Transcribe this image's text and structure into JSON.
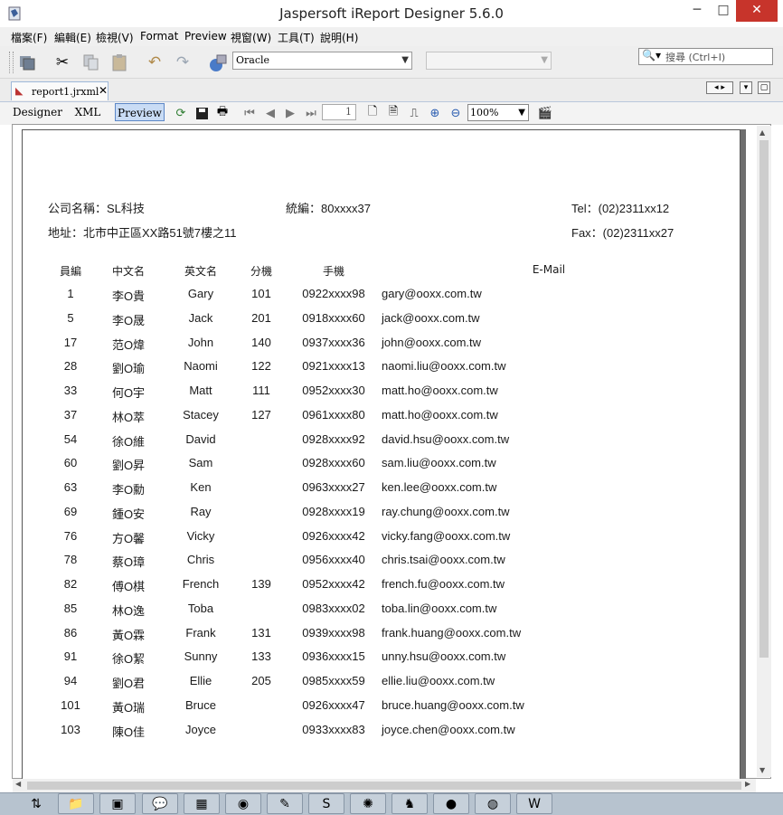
{
  "window": {
    "title": "Jaspersoft iReport Designer 5.6.0",
    "minimize": "─",
    "maximize": "□",
    "close": "✕"
  },
  "menu": [
    "檔案(F)",
    "編輯(E)",
    "檢視(V)",
    "Format",
    "Preview",
    "視窗(W)",
    "工具(T)",
    "說明(H)"
  ],
  "toolbar": {
    "datasource_value": "Oracle",
    "second_combo_value": "",
    "search_placeholder": "搜尋 (Ctrl+I)"
  },
  "tab": {
    "label": "report1.jrxml",
    "close": "✕"
  },
  "editor": {
    "modes": [
      "Designer",
      "XML",
      "Preview"
    ],
    "active_mode": "Preview",
    "page_number": "1",
    "zoom": "100%"
  },
  "report": {
    "company_label": "公司名稱：SL科技",
    "tax_id_label": "統編：80xxxx37",
    "tel_label": "Tel：(02)2311xx12",
    "address_label": "地址：北市中正區XX路51號7樓之11",
    "fax_label": "Fax：(02)2311xx27",
    "columns": [
      "員編",
      "中文名",
      "英文名",
      "分機",
      "手機",
      "E-Mail"
    ],
    "rows": [
      [
        "1",
        "李O貴",
        "Gary",
        "101",
        "0922xxxx98",
        "gary@ooxx.com.tw"
      ],
      [
        "5",
        "李O晟",
        "Jack",
        "201",
        "0918xxxx60",
        "jack@ooxx.com.tw"
      ],
      [
        "17",
        "范O煒",
        "John",
        "140",
        "0937xxxx36",
        "john@ooxx.com.tw"
      ],
      [
        "28",
        "劉O瑜",
        "Naomi",
        "122",
        "0921xxxx13",
        "naomi.liu@ooxx.com.tw"
      ],
      [
        "33",
        "何O宇",
        "Matt",
        "111",
        "0952xxxx30",
        "matt.ho@ooxx.com.tw"
      ],
      [
        "37",
        "林O萃",
        "Stacey",
        "127",
        "0961xxxx80",
        "matt.ho@ooxx.com.tw"
      ],
      [
        "54",
        "徐O維",
        "David",
        "",
        "0928xxxx92",
        "david.hsu@ooxx.com.tw"
      ],
      [
        "60",
        "劉O昇",
        "Sam",
        "",
        "0928xxxx60",
        "sam.liu@ooxx.com.tw"
      ],
      [
        "63",
        "李O勳",
        "Ken",
        "",
        "0963xxxx27",
        "ken.lee@ooxx.com.tw"
      ],
      [
        "69",
        "鍾O安",
        "Ray",
        "",
        "0928xxxx19",
        "ray.chung@ooxx.com.tw"
      ],
      [
        "76",
        "方O馨",
        "Vicky",
        "",
        "0926xxxx42",
        "vicky.fang@ooxx.com.tw"
      ],
      [
        "78",
        "蔡O璋",
        "Chris",
        "",
        "0956xxxx40",
        "chris.tsai@ooxx.com.tw"
      ],
      [
        "82",
        "傅O棋",
        "French",
        "139",
        "0952xxxx42",
        "french.fu@ooxx.com.tw"
      ],
      [
        "85",
        "林O逸",
        "Toba",
        "",
        "0983xxxx02",
        "toba.lin@ooxx.com.tw"
      ],
      [
        "86",
        "黃O霖",
        "Frank",
        "131",
        "0939xxxx98",
        "frank.huang@ooxx.com.tw"
      ],
      [
        "91",
        "徐O絜",
        "Sunny",
        "133",
        "0936xxxx15",
        "unny.hsu@ooxx.com.tw"
      ],
      [
        "94",
        "劉O君",
        "Ellie",
        "205",
        "0985xxxx59",
        "ellie.liu@ooxx.com.tw"
      ],
      [
        "101",
        "黃O瑞",
        "Bruce",
        "",
        "0926xxxx47",
        "bruce.huang@ooxx.com.tw"
      ],
      [
        "103",
        "陳O佳",
        "Joyce",
        "",
        "0933xxxx83",
        "joyce.chen@ooxx.com.tw"
      ]
    ]
  },
  "taskbar": {
    "icons": [
      "network-icon",
      "file-explorer-icon",
      "terminal-icon",
      "line-chat-icon",
      "calculator-icon",
      "chrome-icon",
      "notepad-icon",
      "s-app-icon",
      "settings-wheel-icon",
      "ireport-icon",
      "acorn-icon",
      "globe-icon",
      "word-icon"
    ]
  },
  "colors": {
    "close_button": "#c7342b",
    "active_mode": "#c9dcf5",
    "taskbar": "#b7c3cf"
  }
}
